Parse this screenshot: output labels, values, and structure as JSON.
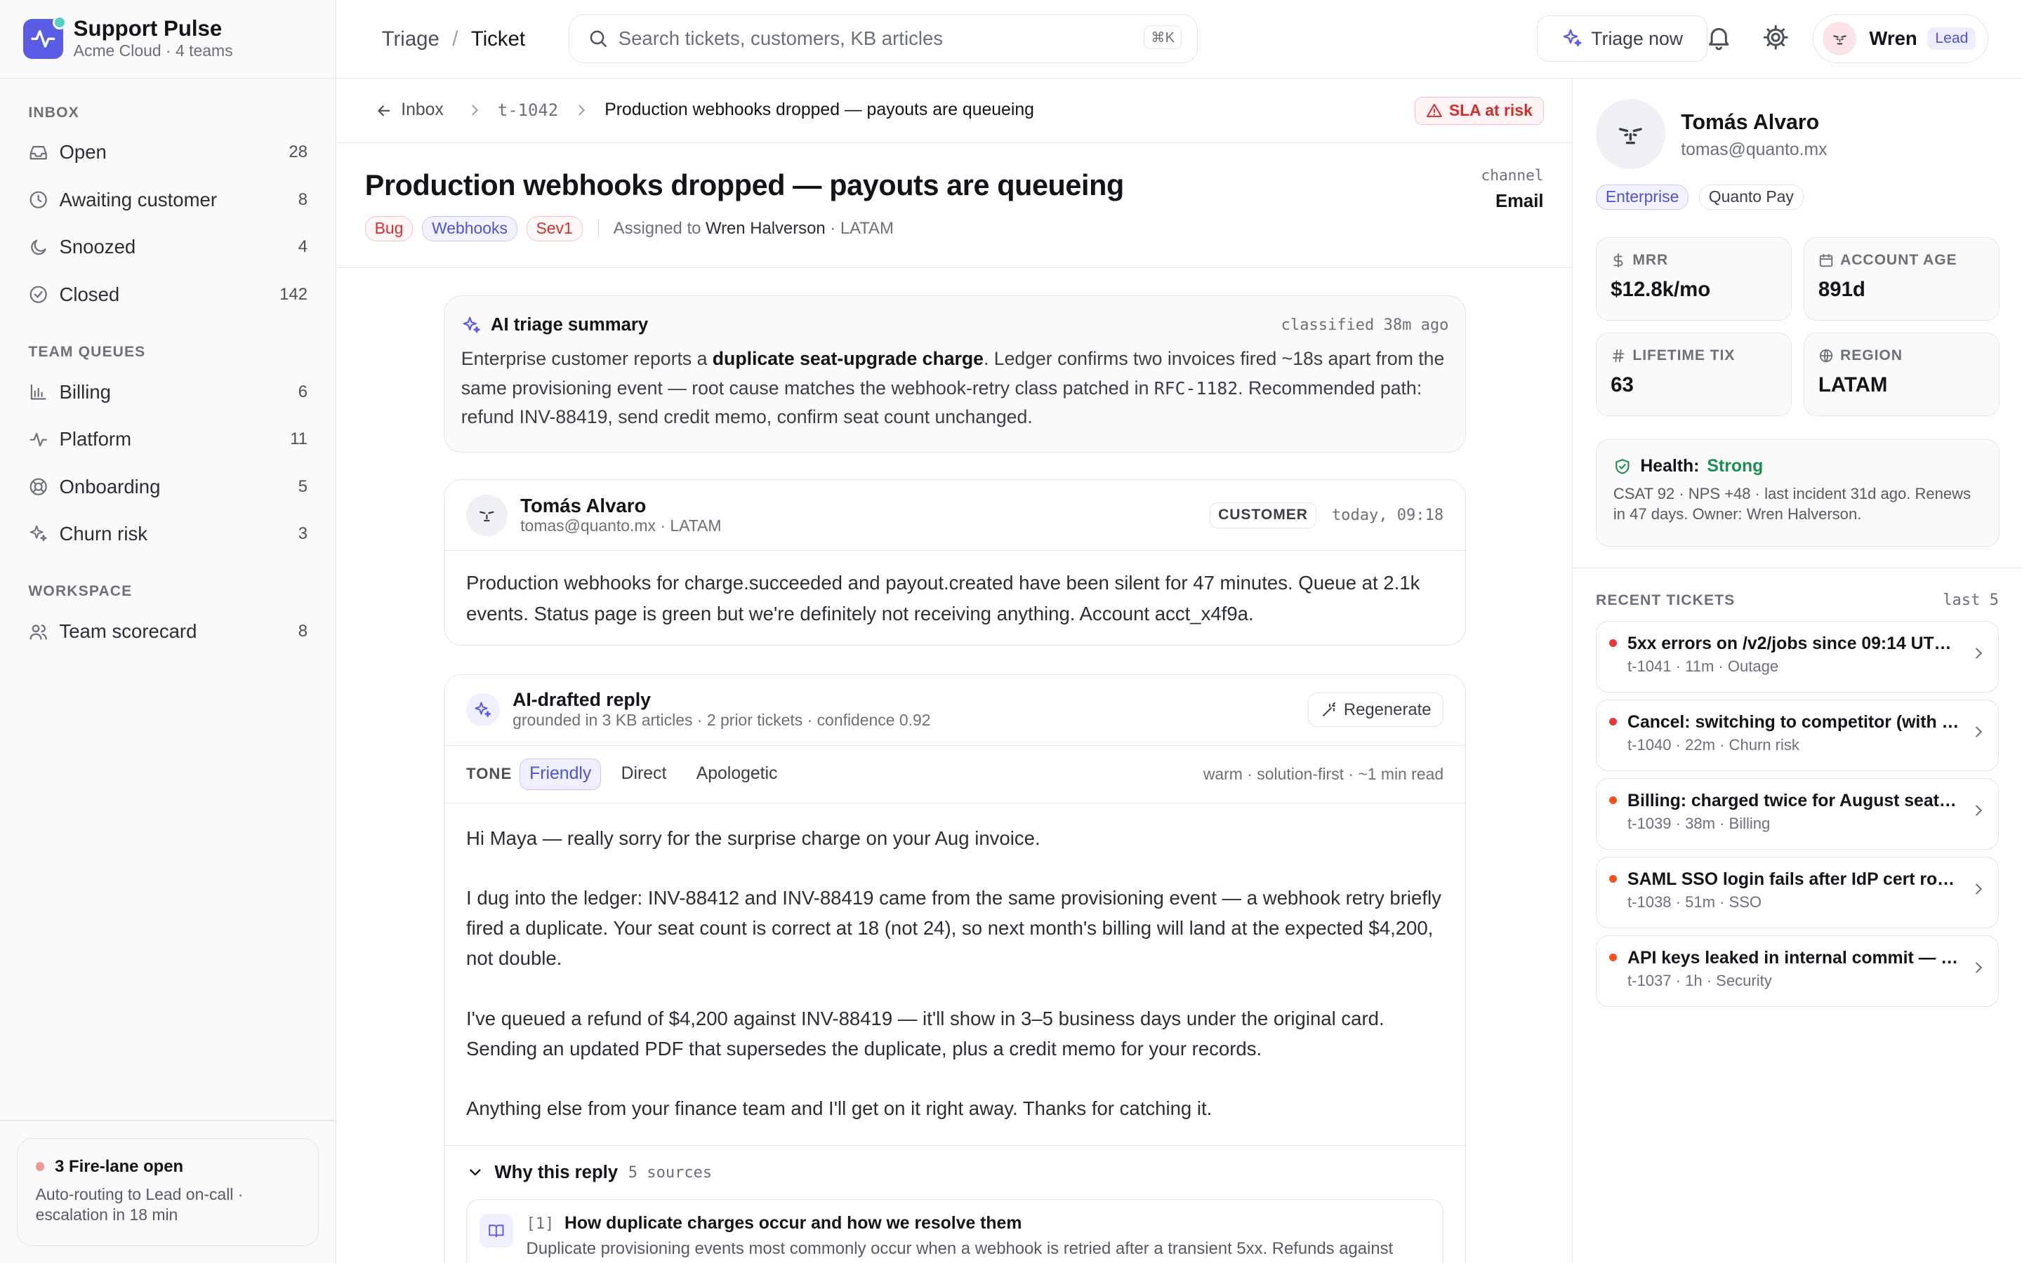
{
  "brand": {
    "name": "Support Pulse",
    "sub": "Acme Cloud · 4 teams"
  },
  "sidebar": {
    "inbox_label": "INBOX",
    "inbox": [
      {
        "label": "Open",
        "count": "28",
        "icon": "inbox-icon"
      },
      {
        "label": "Awaiting customer",
        "count": "8",
        "icon": "clock-icon"
      },
      {
        "label": "Snoozed",
        "count": "4",
        "icon": "moon-icon"
      },
      {
        "label": "Closed",
        "count": "142",
        "icon": "check-circle-icon"
      }
    ],
    "queues_label": "TEAM QUEUES",
    "queues": [
      {
        "label": "Billing",
        "count": "6",
        "icon": "bar-chart-icon"
      },
      {
        "label": "Platform",
        "count": "11",
        "icon": "pulse-icon"
      },
      {
        "label": "Onboarding",
        "count": "5",
        "icon": "lifebuoy-icon"
      },
      {
        "label": "Churn risk",
        "count": "3",
        "icon": "sparkle-icon"
      }
    ],
    "workspace_label": "WORKSPACE",
    "workspace": [
      {
        "label": "Team scorecard",
        "count": "8",
        "icon": "users-icon"
      }
    ],
    "firelane": {
      "title": "3 Fire-lane open",
      "sub": "Auto-routing to Lead on-call · escalation in 18 min"
    }
  },
  "topbar": {
    "crumb1": "Triage",
    "crumb_sep": "/",
    "crumb2": "Ticket",
    "search_placeholder": "Search tickets, customers, KB articles",
    "search_kbd": "⌘K",
    "triage_button": "Triage now",
    "user_name": "Wren",
    "user_role": "Lead"
  },
  "ticket": {
    "back_label": "Inbox",
    "id": "t-1042",
    "crumb_title": "Production webhooks dropped — payouts are queueing",
    "sla": "SLA at risk",
    "title": "Production webhooks dropped — payouts are queueing",
    "tags": [
      "Bug",
      "Webhooks",
      "Sev1"
    ],
    "assigned_prefix": "Assigned to",
    "assignee": "Wren Halverson",
    "region": "· LATAM",
    "channel_label": "channel",
    "channel": "Email"
  },
  "ai_summary": {
    "title": "AI triage summary",
    "when": "classified 38m ago",
    "text_a": "Enterprise customer reports a ",
    "text_bold": "duplicate seat-upgrade charge",
    "text_b": ". Ledger confirms two invoices fired ~18s apart from the same provisioning event — root cause matches the webhook-retry class patched in ",
    "text_code": "RFC-1182",
    "text_c": ". Recommended path: refund INV-88419, send credit memo, confirm seat count unchanged."
  },
  "message": {
    "name": "Tomás Alvaro",
    "meta": "tomas@quanto.mx · LATAM",
    "badge": "CUSTOMER",
    "time": "today, 09:18",
    "body": "Production webhooks for charge.succeeded and payout.created have been silent for 47 minutes. Queue at 2.1k events. Status page is green but we're definitely not receiving anything. Account acct_x4f9a."
  },
  "draft": {
    "title": "AI-drafted reply",
    "sub": "grounded in 3 KB articles · 2 prior tickets · confidence 0.92",
    "regenerate": "Regenerate",
    "tone_label": "TONE",
    "tones": [
      "Friendly",
      "Direct",
      "Apologetic"
    ],
    "tone_meta": "warm · solution-first · ~1 min read",
    "paragraphs": [
      "Hi Maya — really sorry for the surprise charge on your Aug invoice.",
      "I dug into the ledger: INV-88412 and INV-88419 came from the same provisioning event — a webhook retry briefly fired a duplicate. Your seat count is correct at 18 (not 24), so next month's billing will land at the expected $4,200, not double.",
      "I've queued a refund of $4,200 against INV-88419 — it'll show in 3–5 business days under the original card. Sending an updated PDF that supersedes the duplicate, plus a credit memo for your records.",
      "Anything else from your finance team and I'll get on it right away. Thanks for catching it."
    ],
    "why_label": "Why this reply",
    "why_count": "5 sources",
    "source": {
      "num": "[1]",
      "title": "How duplicate charges occur and how we resolve them",
      "snippet": "Duplicate provisioning events most commonly occur when a webhook is retried after a transient 5xx. Refunds against"
    }
  },
  "customer": {
    "name": "Tomás Alvaro",
    "email": "tomas@quanto.mx",
    "tags": [
      "Enterprise",
      "Quanto Pay"
    ],
    "stats": [
      {
        "label": "MRR",
        "value": "$12.8k/mo",
        "icon": "dollar-icon"
      },
      {
        "label": "ACCOUNT AGE",
        "value": "891d",
        "icon": "calendar-icon"
      },
      {
        "label": "LIFETIME TIX",
        "value": "63",
        "icon": "hash-icon"
      },
      {
        "label": "REGION",
        "value": "LATAM",
        "icon": "globe-icon"
      }
    ],
    "health_label": "Health:",
    "health_value": "Strong",
    "health_sub": "CSAT 92 · NPS +48 · last incident 31d ago. Renews in 47 days. Owner: Wren Halverson."
  },
  "recent": {
    "label": "RECENT TICKETS",
    "range": "last 5",
    "items": [
      {
        "title": "5xx errors on /v2/jobs since 09:14 UTC…",
        "meta": "t-1041 · 11m · Outage",
        "dot": "#e53935"
      },
      {
        "title": "Cancel: switching to competitor (with f…",
        "meta": "t-1040 · 22m · Churn risk",
        "dot": "#e53935"
      },
      {
        "title": "Billing: charged twice for August seat …",
        "meta": "t-1039 · 38m · Billing",
        "dot": "#f4511e"
      },
      {
        "title": "SAML SSO login fails after IdP cert rota…",
        "meta": "t-1038 · 51m · SSO",
        "dot": "#f4511e"
      },
      {
        "title": "API keys leaked in internal commit — n…",
        "meta": "t-1037 · 1h · Security",
        "dot": "#f4511e"
      }
    ]
  },
  "colors": {
    "accent": "#5b5ce6",
    "danger": "#d32f2f",
    "success": "#1e8e4e"
  }
}
